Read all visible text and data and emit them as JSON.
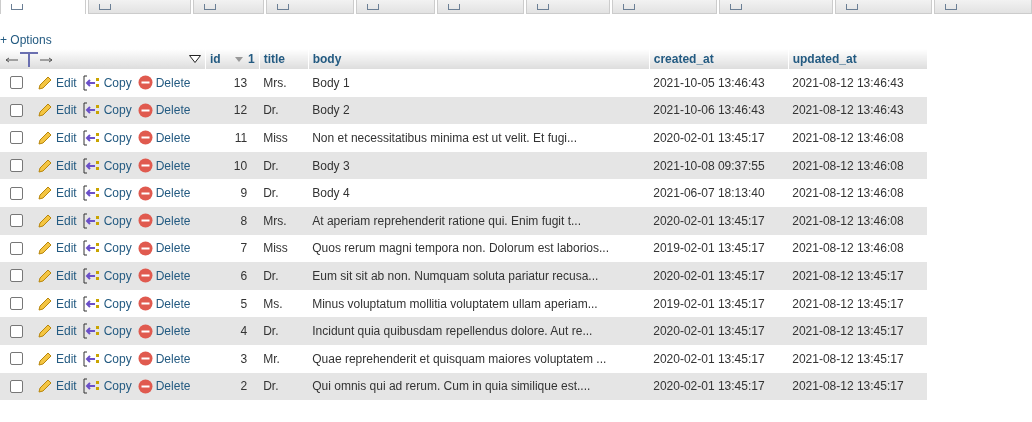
{
  "tabs": [
    {
      "selected": true
    },
    {
      "selected": false
    },
    {
      "selected": false
    },
    {
      "selected": false
    },
    {
      "selected": false
    },
    {
      "selected": false
    },
    {
      "selected": false
    },
    {
      "selected": false
    },
    {
      "selected": false
    },
    {
      "selected": false
    },
    {
      "selected": false
    }
  ],
  "options_link": "+ Options",
  "table": {
    "columns": [
      {
        "label": "id",
        "sort": "1"
      },
      {
        "label": "title"
      },
      {
        "label": "body"
      },
      {
        "label": "created_at"
      },
      {
        "label": "updated_at"
      }
    ],
    "rows": [
      {
        "checked": false,
        "actions": [
          "Edit",
          "Copy",
          "Delete"
        ],
        "cells": [
          "13",
          "Mrs.",
          "Body 1",
          "2021-10-05 13:46:43",
          "2021-08-12 13:46:43"
        ]
      },
      {
        "checked": false,
        "actions": [
          "Edit",
          "Copy",
          "Delete"
        ],
        "cells": [
          "12",
          "Dr.",
          "Body 2",
          "2021-10-06 13:46:43",
          "2021-08-12 13:46:43"
        ]
      },
      {
        "checked": false,
        "actions": [
          "Edit",
          "Copy",
          "Delete"
        ],
        "cells": [
          "11",
          "Miss",
          "Non et necessitatibus minima est ut velit. Et fugi...",
          "2020-02-01 13:45:17",
          "2021-08-12 13:46:08"
        ]
      },
      {
        "checked": false,
        "actions": [
          "Edit",
          "Copy",
          "Delete"
        ],
        "cells": [
          "10",
          "Dr.",
          "Body 3",
          "2021-10-08 09:37:55",
          "2021-08-12 13:46:08"
        ]
      },
      {
        "checked": false,
        "actions": [
          "Edit",
          "Copy",
          "Delete"
        ],
        "cells": [
          "9",
          "Dr.",
          "Body 4",
          "2021-06-07 18:13:40",
          "2021-08-12 13:46:08"
        ]
      },
      {
        "checked": false,
        "actions": [
          "Edit",
          "Copy",
          "Delete"
        ],
        "cells": [
          "8",
          "Mrs.",
          "At aperiam reprehenderit ratione qui. Enim fugit t...",
          "2020-02-01 13:45:17",
          "2021-08-12 13:46:08"
        ]
      },
      {
        "checked": false,
        "actions": [
          "Edit",
          "Copy",
          "Delete"
        ],
        "cells": [
          "7",
          "Miss",
          "Quos rerum magni tempora non. Dolorum est laborios...",
          "2019-02-01 13:45:17",
          "2021-08-12 13:46:08"
        ]
      },
      {
        "checked": false,
        "actions": [
          "Edit",
          "Copy",
          "Delete"
        ],
        "cells": [
          "6",
          "Dr.",
          "Eum sit sit ab non. Numquam soluta pariatur recusa...",
          "2020-02-01 13:45:17",
          "2021-08-12 13:45:17"
        ]
      },
      {
        "checked": false,
        "actions": [
          "Edit",
          "Copy",
          "Delete"
        ],
        "cells": [
          "5",
          "Ms.",
          "Minus voluptatum mollitia voluptatem ullam aperiam...",
          "2019-02-01 13:45:17",
          "2021-08-12 13:45:17"
        ]
      },
      {
        "checked": false,
        "actions": [
          "Edit",
          "Copy",
          "Delete"
        ],
        "cells": [
          "4",
          "Dr.",
          "Incidunt quia quibusdam repellendus dolore. Aut re...",
          "2020-02-01 13:45:17",
          "2021-08-12 13:45:17"
        ]
      },
      {
        "checked": false,
        "actions": [
          "Edit",
          "Copy",
          "Delete"
        ],
        "cells": [
          "3",
          "Mr.",
          "Quae reprehenderit et quisquam maiores voluptatem ...",
          "2020-02-01 13:45:17",
          "2021-08-12 13:45:17"
        ]
      },
      {
        "checked": false,
        "actions": [
          "Edit",
          "Copy",
          "Delete"
        ],
        "cells": [
          "2",
          "Dr.",
          "Qui omnis qui ad rerum. Cum in quia similique est....",
          "2020-02-01 13:45:17",
          "2021-08-12 13:45:17"
        ]
      }
    ]
  }
}
